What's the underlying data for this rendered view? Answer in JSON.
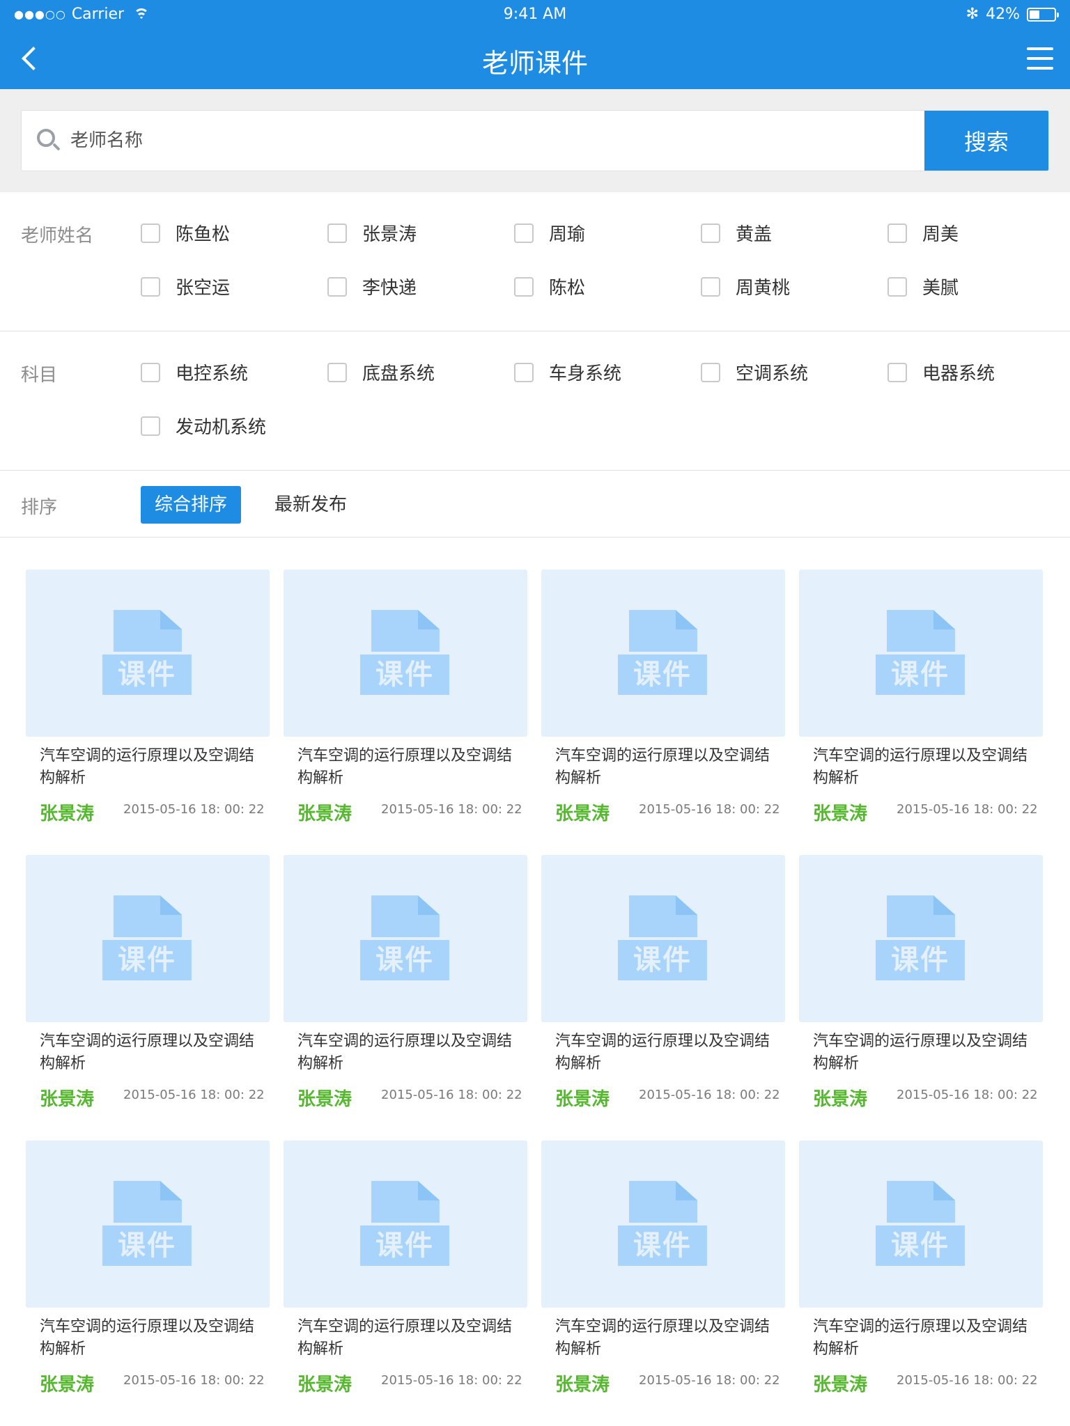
{
  "status_bar": {
    "carrier": "Carrier",
    "signal": "●●●○○",
    "time": "9:41 AM",
    "bluetooth": "✻",
    "battery_text": "42%",
    "battery_level": 0.42
  },
  "nav": {
    "title": "老师课件"
  },
  "search": {
    "placeholder": "老师名称",
    "button": "搜索"
  },
  "filters": {
    "teacher": {
      "label": "老师姓名",
      "options": [
        "陈鱼松",
        "张景涛",
        "周瑜",
        "黄盖",
        "周美",
        "张空运",
        "李快递",
        "陈松",
        "周黄桃",
        "美腻"
      ]
    },
    "subject": {
      "label": "科目",
      "options": [
        "电控系统",
        "底盘系统",
        "车身系统",
        "空调系统",
        "电器系统",
        "发动机系统"
      ]
    },
    "sort": {
      "label": "排序",
      "options": [
        "综合排序",
        "最新发布"
      ],
      "active": "综合排序"
    }
  },
  "cards": [
    {
      "thumb": "课件",
      "title": "汽车空调的运行原理以及空调结构解析",
      "author": "张景涛",
      "date": "2015-05-16 18: 00: 22"
    },
    {
      "thumb": "课件",
      "title": "汽车空调的运行原理以及空调结构解析",
      "author": "张景涛",
      "date": "2015-05-16 18: 00: 22"
    },
    {
      "thumb": "课件",
      "title": "汽车空调的运行原理以及空调结构解析",
      "author": "张景涛",
      "date": "2015-05-16 18: 00: 22"
    },
    {
      "thumb": "课件",
      "title": "汽车空调的运行原理以及空调结构解析",
      "author": "张景涛",
      "date": "2015-05-16 18: 00: 22"
    },
    {
      "thumb": "课件",
      "title": "汽车空调的运行原理以及空调结构解析",
      "author": "张景涛",
      "date": "2015-05-16 18: 00: 22"
    },
    {
      "thumb": "课件",
      "title": "汽车空调的运行原理以及空调结构解析",
      "author": "张景涛",
      "date": "2015-05-16 18: 00: 22"
    },
    {
      "thumb": "课件",
      "title": "汽车空调的运行原理以及空调结构解析",
      "author": "张景涛",
      "date": "2015-05-16 18: 00: 22"
    },
    {
      "thumb": "课件",
      "title": "汽车空调的运行原理以及空调结构解析",
      "author": "张景涛",
      "date": "2015-05-16 18: 00: 22"
    },
    {
      "thumb": "课件",
      "title": "汽车空调的运行原理以及空调结构解析",
      "author": "张景涛",
      "date": "2015-05-16 18: 00: 22"
    },
    {
      "thumb": "课件",
      "title": "汽车空调的运行原理以及空调结构解析",
      "author": "张景涛",
      "date": "2015-05-16 18: 00: 22"
    },
    {
      "thumb": "课件",
      "title": "汽车空调的运行原理以及空调结构解析",
      "author": "张景涛",
      "date": "2015-05-16 18: 00: 22"
    },
    {
      "thumb": "课件",
      "title": "汽车空调的运行原理以及空调结构解析",
      "author": "张景涛",
      "date": "2015-05-16 18: 00: 22"
    }
  ],
  "colors": {
    "primary": "#1e8ce3",
    "author": "#55b82e",
    "thumb_bg": "#e4f0fb",
    "doc_icon": "#a8d3fb"
  }
}
